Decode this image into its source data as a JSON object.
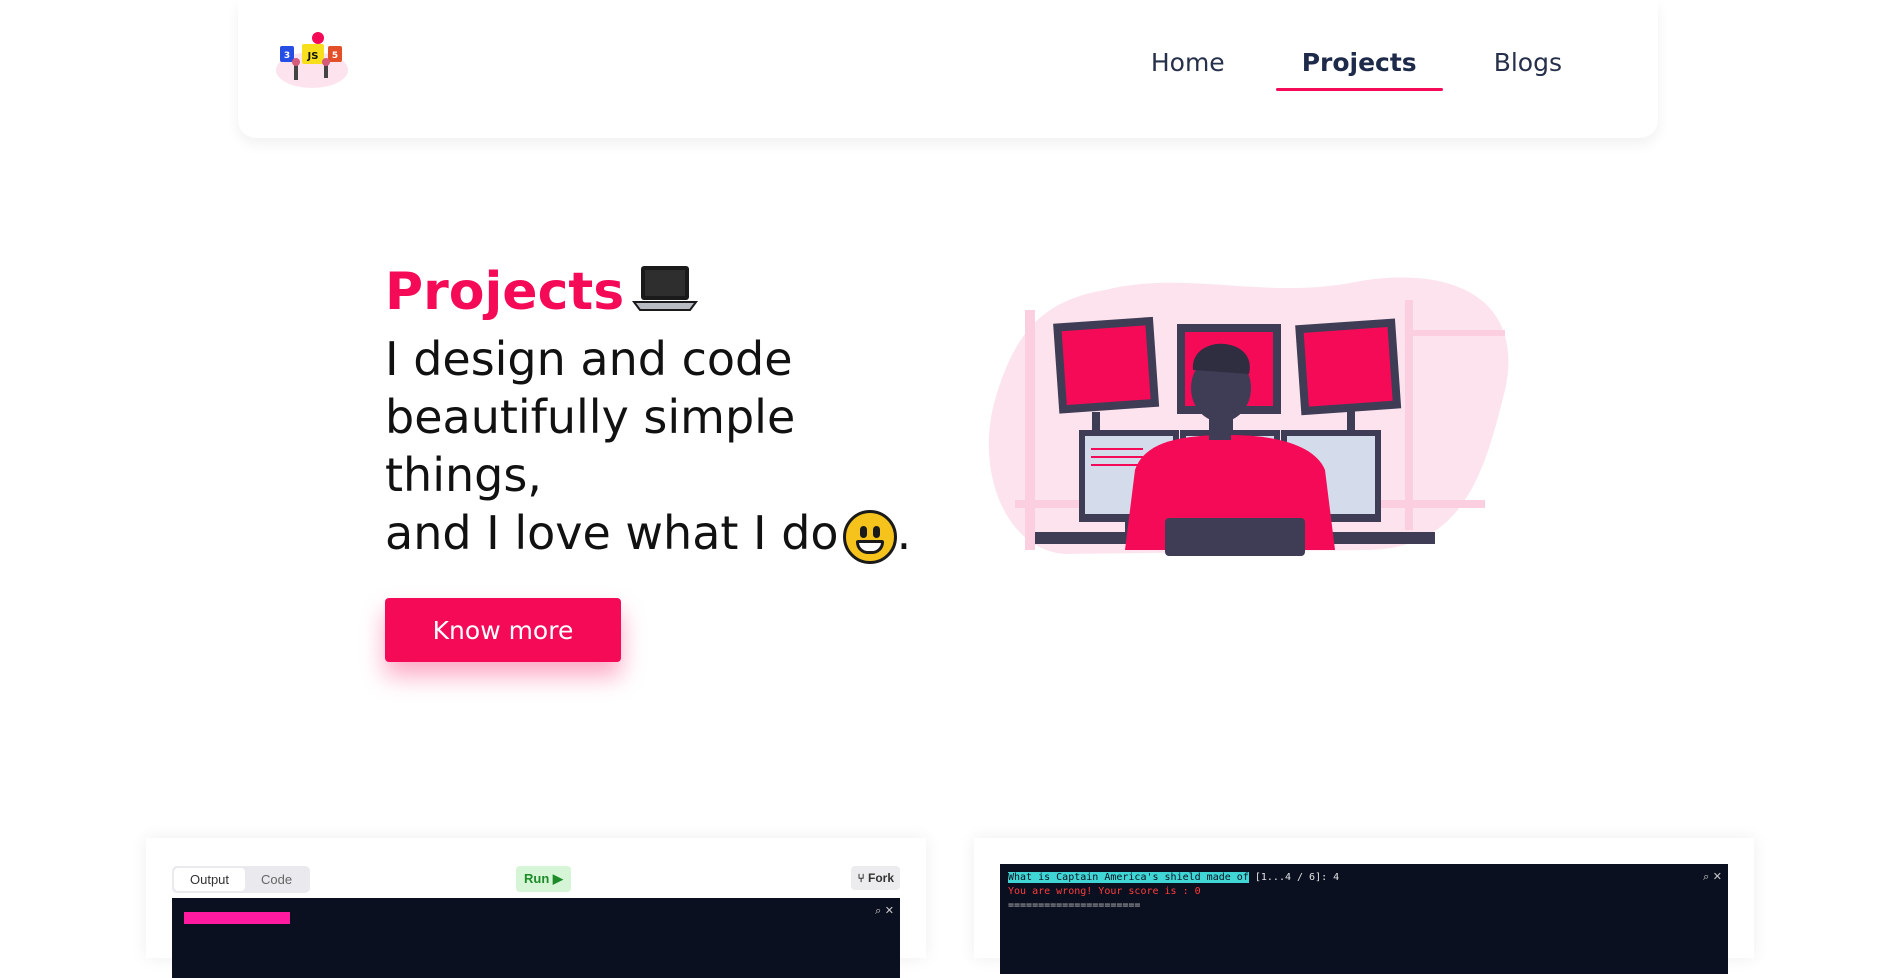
{
  "nav": {
    "items": [
      {
        "label": "Home",
        "active": false
      },
      {
        "label": "Projects",
        "active": true
      },
      {
        "label": "Blogs",
        "active": false
      }
    ]
  },
  "hero": {
    "title": "Projects",
    "title_icon": "laptop-emoji",
    "lines": [
      "I design and code",
      "beautifully simple",
      "things,",
      "and I love what I do"
    ],
    "end_emoji": "smiley-emoji",
    "end_punct": ".",
    "button_label": "Know more"
  },
  "cards": {
    "left": {
      "tabs": [
        "Output",
        "Code"
      ],
      "active_tab": "Output",
      "run_label": "Run",
      "fork_label": "Fork"
    },
    "right": {
      "question": "What is Captain America's shield made of",
      "question_suffix": "[1...4 / 6]: 4",
      "result": "You are wrong! Your score is : 0",
      "separator": "======================"
    }
  },
  "colors": {
    "accent": "#f50a58",
    "nav_text": "#26304a",
    "terminal_bg": "#0b1020"
  }
}
